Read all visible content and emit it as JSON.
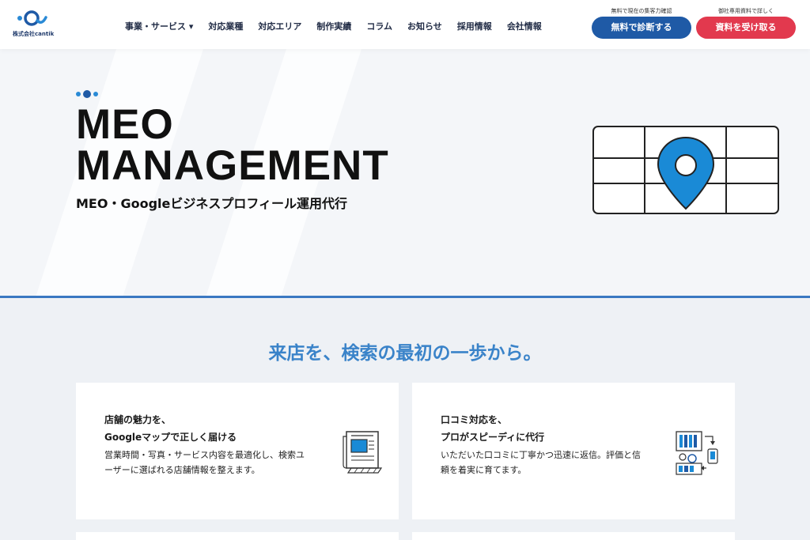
{
  "header": {
    "logo_text": "株式会社cantik",
    "nav": [
      {
        "label": "事業・サービス ▾"
      },
      {
        "label": "対応業種"
      },
      {
        "label": "対応エリア"
      },
      {
        "label": "制作実績"
      },
      {
        "label": "コラム"
      },
      {
        "label": "お知らせ"
      },
      {
        "label": "採用情報"
      },
      {
        "label": "会社情報"
      }
    ],
    "cta_diagnosis": {
      "note": "無料で現在の集客力確認",
      "label": "無料で診断する"
    },
    "cta_docs": {
      "note": "御社専用資料で詳しく",
      "label": "資料を受け取る"
    }
  },
  "hero": {
    "title_line1": "MEO",
    "title_line2": "MANAGEMENT",
    "subtitle": "MEO・Googleビジネスプロフィール運用代行"
  },
  "section": {
    "title": "来店を、検索の最初の一歩から。",
    "cards": [
      {
        "title_line1": "店舗の魅力を、",
        "title_line2": "Googleマップで正しく届ける",
        "body": "営業時間・写真・サービス内容を最適化し、検索ユーザーに選ばれる店舗情報を整えます。",
        "icon": "newspaper-icon"
      },
      {
        "title_line1": "口コミ対応を、",
        "title_line2": "プロがスピーディに代行",
        "body": "いただいた口コミに丁寧かつ迅速に返信。評価と信頼を着実に育てます。",
        "icon": "dashboard-icon"
      }
    ]
  },
  "colors": {
    "primary_blue": "#1f5aa6",
    "accent_red": "#e2394e",
    "heading_blue": "#3a83c9",
    "pin_blue": "#1a8ad6"
  }
}
